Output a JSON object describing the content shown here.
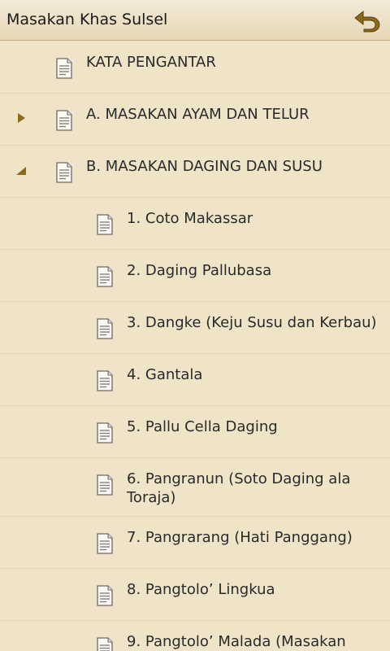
{
  "app": {
    "title": "Masakan Khas Sulsel",
    "back_icon": "undo-arrow-icon",
    "accent_color": "#8a6a1c",
    "background_color": "#efe3c8"
  },
  "items": [
    {
      "label": "KATA PENGANTAR",
      "level": 0,
      "expander": "none",
      "icon": "document-icon"
    },
    {
      "label": "A. MASAKAN AYAM DAN TELUR",
      "level": 0,
      "expander": "collapsed",
      "icon": "document-icon"
    },
    {
      "label": "B. MASAKAN DAGING DAN SUSU",
      "level": 0,
      "expander": "expanded",
      "icon": "document-icon"
    },
    {
      "label": "1. Coto Makassar",
      "level": 1,
      "expander": "none",
      "icon": "document-icon"
    },
    {
      "label": "2. Daging Pallubasa",
      "level": 1,
      "expander": "none",
      "icon": "document-icon"
    },
    {
      "label": "3. Dangke (Keju Susu dan Kerbau)",
      "level": 1,
      "expander": "none",
      "icon": "document-icon"
    },
    {
      "label": "4. Gantala",
      "level": 1,
      "expander": "none",
      "icon": "document-icon"
    },
    {
      "label": "5. Pallu Cella Daging",
      "level": 1,
      "expander": "none",
      "icon": "document-icon"
    },
    {
      "label": "6. Pangranun (Soto Daging ala Toraja)",
      "level": 1,
      "expander": "none",
      "icon": "document-icon"
    },
    {
      "label": "7. Pangrarang (Hati Panggang)",
      "level": 1,
      "expander": "none",
      "icon": "document-icon"
    },
    {
      "label": "8. Pangtolo’ Lingkua",
      "level": 1,
      "expander": "none",
      "icon": "document-icon"
    },
    {
      "label": "9. Pangtolo’ Malada (Masakan",
      "level": 1,
      "expander": "none",
      "icon": "document-icon"
    }
  ]
}
